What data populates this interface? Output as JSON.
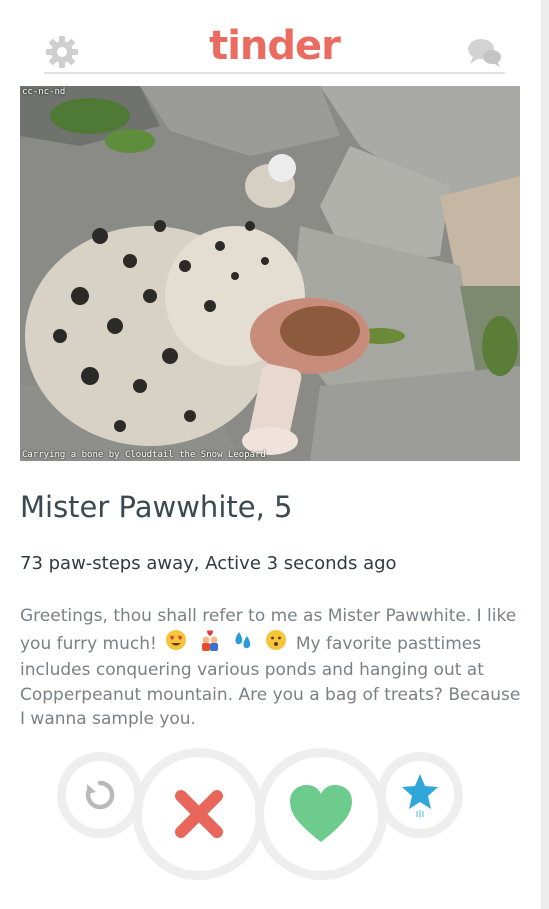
{
  "header": {
    "logo": "tinder",
    "settings_icon": "gear-icon",
    "messages_icon": "chat-bubbles-icon"
  },
  "photo": {
    "license": "cc-nc-nd",
    "caption": "Carrying a bone by Cloudtail the Snow Leopard"
  },
  "profile": {
    "name": "Mister Pawwhite, 5",
    "distance": "73 paw-steps away, Active 3 seconds ago",
    "bio_part1": "Greetings, thou shall refer to me as Mister Pawwhite. I like you furry much!",
    "bio_part2": "My favorite pasttimes includes conquering various ponds and hanging out at Copperpeanut mountain. Are you a bag of treats? Because I wanna sample you.",
    "bio_emojis": [
      "heart-eyes-emoji",
      "couple-emoji",
      "droplets-emoji",
      "blush-face-emoji"
    ]
  },
  "actions": {
    "rewind_icon": "rewind-icon",
    "nope_icon": "close-icon",
    "like_icon": "heart-icon",
    "superlike_icon": "star-icon"
  },
  "colors": {
    "brand": "#ea6b60",
    "nope": "#e8665a",
    "like": "#6dcb8e",
    "superlike": "#2fa7d9",
    "rewind": "#b9b9b9"
  }
}
